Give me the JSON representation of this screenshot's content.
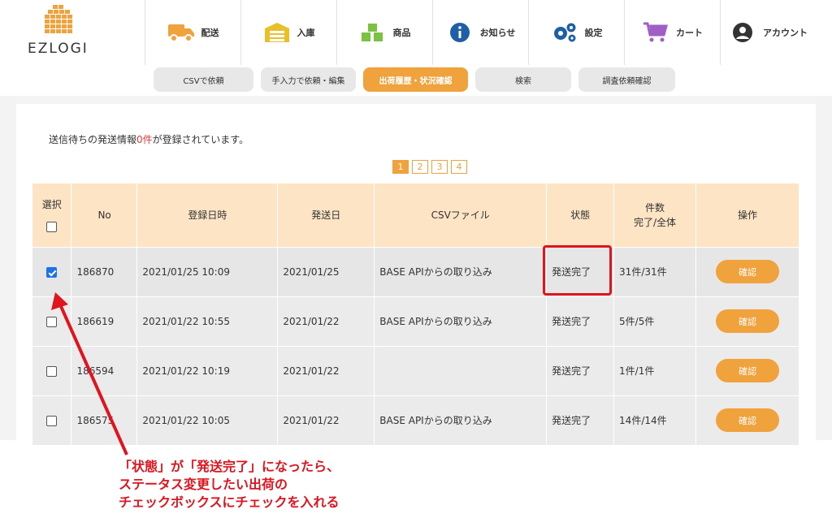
{
  "logo": {
    "text": "EZLOGI"
  },
  "nav": [
    {
      "label": "配送",
      "icon": "truck-icon"
    },
    {
      "label": "入庫",
      "icon": "warehouse-icon"
    },
    {
      "label": "商品",
      "icon": "boxes-icon"
    },
    {
      "label": "お知らせ",
      "icon": "info-icon"
    },
    {
      "label": "設定",
      "icon": "gear-icon"
    },
    {
      "label": "カート",
      "icon": "cart-icon"
    },
    {
      "label": "アカウント",
      "icon": "user-icon"
    }
  ],
  "subtabs": [
    {
      "label": "CSVで依頼",
      "active": false
    },
    {
      "label": "手入力で依頼・編集",
      "active": false
    },
    {
      "label": "出荷履歴・状況確認",
      "active": true
    },
    {
      "label": "検索",
      "active": false
    },
    {
      "label": "調査依頼確認",
      "active": false
    }
  ],
  "notice": {
    "prefix": "送信待ちの発送情報",
    "count": "0件",
    "suffix": "が登録されています。"
  },
  "pager": [
    "1",
    "2",
    "3",
    "4"
  ],
  "table": {
    "headers": {
      "select": "選択",
      "no": "No",
      "registered": "登録日時",
      "shipped": "発送日",
      "csv": "CSVファイル",
      "status": "状態",
      "count_line1": "件数",
      "count_line2": "完了/全体",
      "action": "操作"
    },
    "rows": [
      {
        "checked": true,
        "no": "186870",
        "registered": "2021/01/25 10:09",
        "shipped": "2021/01/25",
        "csv": "BASE APIからの取り込み",
        "status": "発送完了",
        "count": "31件/31件",
        "action": "確認"
      },
      {
        "checked": false,
        "no": "186619",
        "registered": "2021/01/22 10:55",
        "shipped": "2021/01/22",
        "csv": "BASE APIからの取り込み",
        "status": "発送完了",
        "count": "5件/5件",
        "action": "確認"
      },
      {
        "checked": false,
        "no": "186594",
        "registered": "2021/01/22 10:19",
        "shipped": "2021/01/22",
        "csv": "",
        "status": "発送完了",
        "count": "1件/1件",
        "action": "確認"
      },
      {
        "checked": false,
        "no": "186575",
        "registered": "2021/01/22 10:05",
        "shipped": "2021/01/22",
        "csv": "BASE APIからの取り込み",
        "status": "発送完了",
        "count": "14件/14件",
        "action": "確認"
      }
    ]
  },
  "annotation": {
    "line1": "「状態」が「発送完了」になったら、",
    "line2": "ステータス変更したい出荷の",
    "line3": "チェックボックスにチェックを入れる"
  },
  "colors": {
    "accent": "#f0a23c",
    "annotation": "#e0141e",
    "header_bg": "#fce4c5",
    "checkbox": "#1a73e8"
  }
}
